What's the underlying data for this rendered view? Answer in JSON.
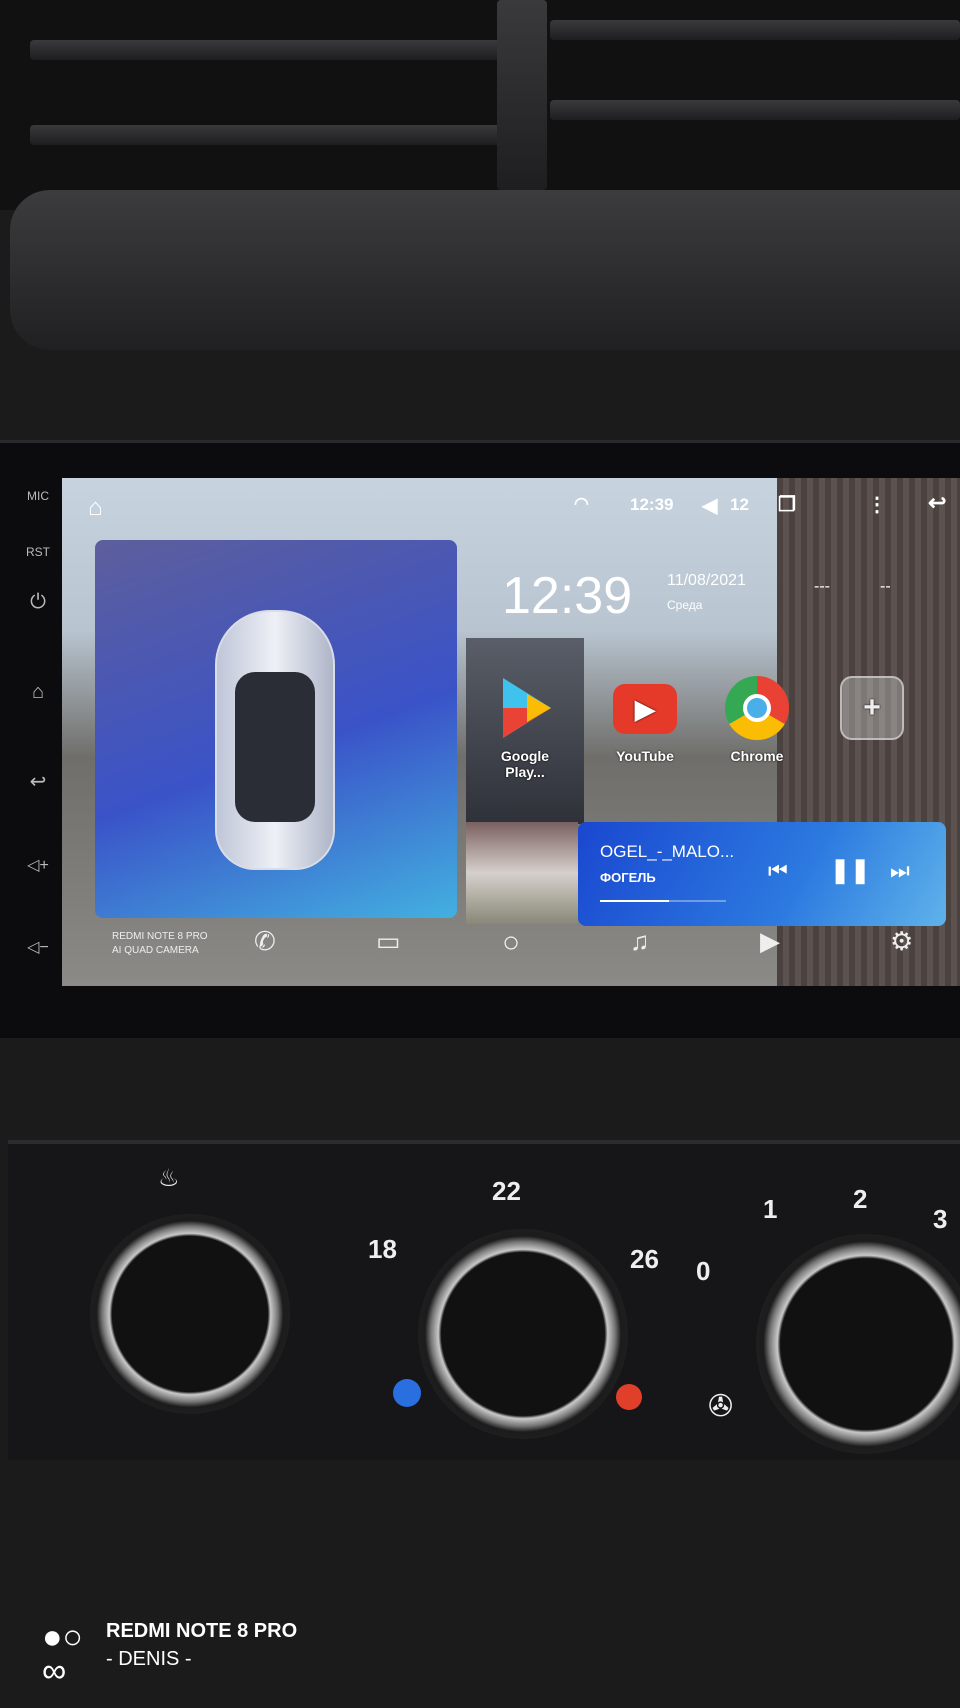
{
  "side_buttons": {
    "mic": "MIC",
    "rst": "RST"
  },
  "status_bar": {
    "time": "12:39",
    "volume": "12",
    "icons": [
      "home-icon",
      "wifi-icon",
      "volume-icon",
      "recent-apps-icon",
      "more-icon",
      "back-icon"
    ]
  },
  "clock_widget": {
    "time": "12:39",
    "date": "11/08/2021",
    "weekday": "Среда",
    "weather_temp": "---",
    "weather_extra": "--"
  },
  "apps": [
    {
      "label": "Google Play...",
      "icon": "google-play-icon"
    },
    {
      "label": "YouTube",
      "icon": "youtube-icon",
      "color": "#e53a2a"
    },
    {
      "label": "Chrome",
      "icon": "chrome-icon"
    },
    {
      "label": "+",
      "icon": "add-app-icon"
    }
  ],
  "music": {
    "title": "OGEL_-_MALO...",
    "artist": "ФОГЕЛЬ",
    "progress": 0.55
  },
  "photo_overlay": {
    "line1": "REDMI NOTE 8 PRO",
    "line2": "AI QUAD CAMERA"
  },
  "dock": [
    "phone-icon",
    "radio-icon",
    "home-circle-icon",
    "music-icon",
    "video-icon",
    "settings-icon"
  ],
  "climate": {
    "temp_labels": [
      "18",
      "22",
      "26"
    ],
    "fan_labels": [
      "0",
      "1",
      "2",
      "3"
    ]
  },
  "watermark": {
    "line1": "REDMI NOTE 8 PRO",
    "line2": "- DENIS -"
  },
  "colors": {
    "music_card": "#1a47d0",
    "cold": "#2a6fe0",
    "hot": "#e0402a"
  }
}
